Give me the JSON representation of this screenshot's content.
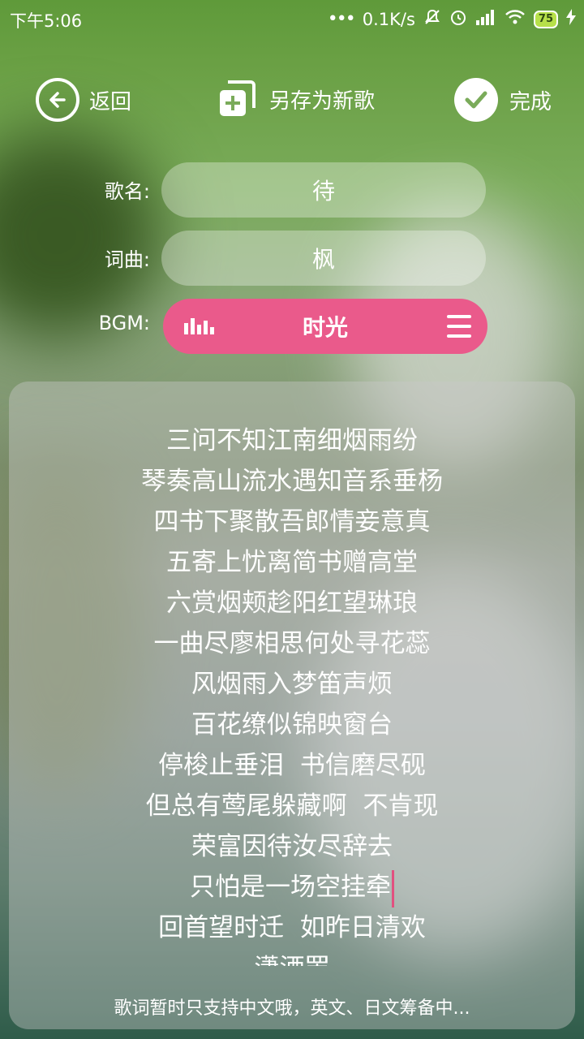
{
  "status_bar": {
    "time": "下午5:06",
    "net_speed": "0.1K/s",
    "battery": "75"
  },
  "actions": {
    "back_label": "返回",
    "save_as_label": "另存为新歌",
    "done_label": "完成"
  },
  "form": {
    "song_name_label": "歌名:",
    "song_name_value": "待",
    "lyricist_label": "词曲:",
    "lyricist_value": "枫",
    "bgm_label": "BGM:",
    "bgm_value": "时光"
  },
  "lyrics": [
    "三问不知江南细烟雨纷",
    "琴奏高山流水遇知音系垂杨",
    "四书下聚散吾郎情妾意真",
    "五寄上忧离简书赠高堂",
    "六赏烟颊趁阳红望琳琅",
    "一曲尽廖相思何处寻花蕊",
    "风烟雨入梦笛声烦",
    "百花缭似锦映窗台",
    "停梭止垂泪  书信磨尽砚",
    "但总有莺尾躲藏啊  不肯现",
    "荣富因待汝尽辞去",
    "只怕是一场空挂牵",
    "回首望时迁  如昨日清欢",
    "潇洒罢"
  ],
  "hint": "歌词暂时只支持中文哦，英文、日文筹备中...",
  "colors": {
    "accent": "#ea5a8b",
    "cursor": "#e2507f",
    "battery": "#b7e04a"
  }
}
